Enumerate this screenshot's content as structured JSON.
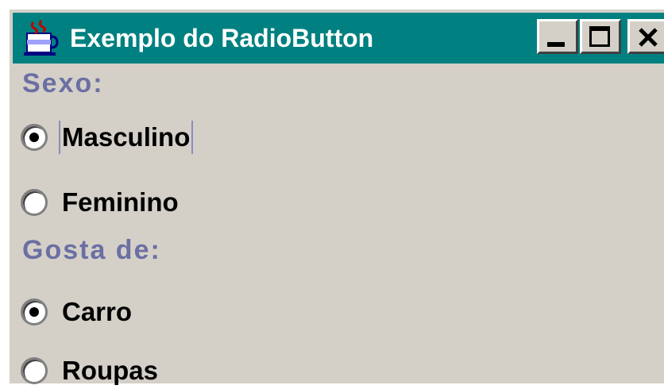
{
  "window": {
    "title": "Exemplo do RadioButton",
    "title_bar_color": "#008080",
    "controls": {
      "minimize_icon": "minimize-icon",
      "maximize_icon": "maximize-icon",
      "close_icon": "close-icon"
    }
  },
  "app_icon": "java-cup-icon",
  "colors": {
    "section_label": "#6b6fa3",
    "background": "#d4d0c8"
  },
  "groups": [
    {
      "label": "Sexo:",
      "options": [
        {
          "label": "Masculino",
          "selected": true,
          "focused": true
        },
        {
          "label": "Feminino",
          "selected": false,
          "focused": false
        }
      ]
    },
    {
      "label": "Gosta de:",
      "options": [
        {
          "label": "Carro",
          "selected": true,
          "focused": false
        },
        {
          "label": "Roupas",
          "selected": false,
          "focused": false
        }
      ]
    }
  ]
}
